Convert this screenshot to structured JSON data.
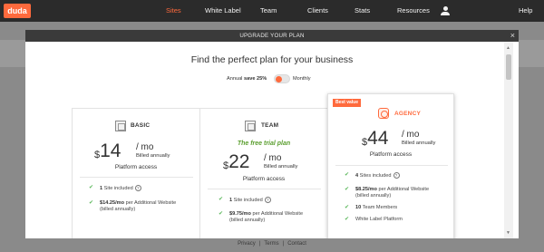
{
  "topnav": {
    "logo": "duda",
    "items": [
      {
        "label": "Sites",
        "active": true
      },
      {
        "label": "White Label"
      },
      {
        "label": "Team"
      },
      {
        "label": "Clients"
      },
      {
        "label": "Stats"
      },
      {
        "label": "Resources"
      }
    ],
    "user_icon": "user-icon",
    "help": "Help"
  },
  "footer": {
    "privacy": "Privacy",
    "sep1": "|",
    "terms": "Terms",
    "sep2": "|",
    "contact": "Contact"
  },
  "modal": {
    "title": "UPGRADE YOUR PLAN",
    "close": "×",
    "headline": "Find the perfect plan for your business",
    "billing": {
      "annual_prefix": "Annual ",
      "annual_save": "save 25%",
      "monthly": "Monthly",
      "selected": "Annual"
    }
  },
  "plans": {
    "basic": {
      "name": "BASIC",
      "currency": "$",
      "price": "14",
      "per": "/ mo",
      "billed": "Billed annually",
      "platform": "Platform access",
      "features": [
        {
          "bold": "1",
          "text": " Site included",
          "info": "?"
        },
        {
          "bold": "$14.25/mo",
          "text": " per Additional Website",
          "text2": "(billed annually)"
        }
      ]
    },
    "team": {
      "name": "TEAM",
      "subtitle": "The free trial plan",
      "currency": "$",
      "price": "22",
      "per": "/ mo",
      "billed": "Billed annually",
      "platform": "Platform access",
      "features": [
        {
          "bold": "1",
          "text": " Site included",
          "info": "?"
        },
        {
          "bold": "$9.75/mo",
          "text": " per Additional Website",
          "text2": "(billed annually)"
        }
      ]
    },
    "agency": {
      "badge": "Best value",
      "name": "AGENCY",
      "currency": "$",
      "price": "44",
      "per": "/ mo",
      "billed": "Billed annually",
      "platform": "Platform access",
      "features": [
        {
          "bold": "4",
          "text": " Sites included",
          "info": "?"
        },
        {
          "bold": "$8.25/mo",
          "text": " per Additional Website",
          "text2": "(billed annually)"
        },
        {
          "bold": "10",
          "text": " Team Members"
        },
        {
          "text": "White Label Platform"
        }
      ]
    }
  },
  "colors": {
    "accent": "#ff6a3d",
    "nav_bg": "#2b2b2b",
    "trial_green": "#5a9e2e",
    "check_green": "#5cb85c"
  }
}
